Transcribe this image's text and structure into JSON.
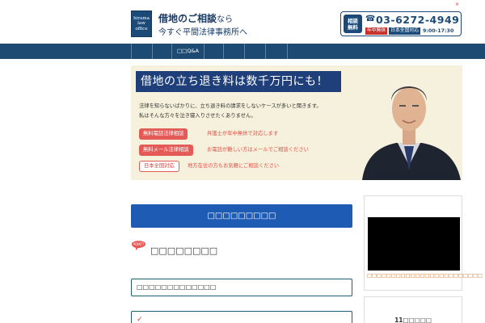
{
  "header": {
    "corner_mark": "×",
    "logo_lines": [
      "hirama",
      "law",
      "office"
    ],
    "tagline_main": "借地のご相談",
    "tagline_suffix": "なら",
    "tagline_sub": "今すぐ平間法律事務所へ",
    "contact": {
      "free_badge": [
        "相談",
        "無料"
      ],
      "phone_icon": "phone-icon",
      "phone": "03-6272-4949",
      "hours": [
        "年中無休",
        "日本全国対応"
      ],
      "time": "9:00-17:30"
    }
  },
  "nav": {
    "items": [
      {
        "label": ""
      },
      {
        "label": ""
      },
      {
        "label": "□□Q&A"
      },
      {
        "label": ""
      },
      {
        "label": ""
      },
      {
        "label": ""
      },
      {
        "label": ""
      }
    ]
  },
  "hero": {
    "title": "借地の立ち退き料は数千万円にも！",
    "body_line1": "法律を知らないばかりに、立ち退き料の請求をしないケースが多いと聞きます。",
    "body_line2": "私はそんな方々を泣き寝入りさせたくありません。",
    "cta": [
      {
        "badge": "無料電話法律相談",
        "text": "弁護士が年中無休で対応します"
      },
      {
        "badge": "無料メール法律相談",
        "text": "お電話が難しい方はメールでご相談ください"
      },
      {
        "badge": "日本全国対応",
        "text": "地方在住の方もお気軽にご相談ください"
      }
    ]
  },
  "main": {
    "primary_button": "□□□□□□□□□",
    "point_label": "POINT!",
    "point_heading": "□□□□□□□□",
    "input_value": "□□□□□□□□□□□□□",
    "check_mark": "✓"
  },
  "sidebar": {
    "video_caption": "□□□□□□□□□□□□□□□□□□□□□□□□",
    "box2_title": "11□□□□□"
  },
  "colors": {
    "brand_navy": "#1b4a78",
    "nav_bar": "#1d4a72",
    "accent_red": "#e35a57",
    "button_blue": "#1e5bb4",
    "hero_bg": "#f6f1dc"
  }
}
